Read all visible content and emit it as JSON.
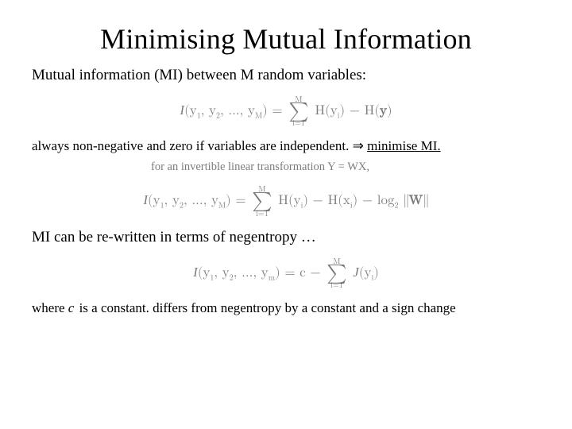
{
  "title": "Minimising Mutual Information",
  "subtitle": "Mutual information (MI) between M random variables:",
  "eq1": {
    "lhs": "I(y₁, y₂, …, y_M) = ",
    "sum_top": "M",
    "sum_bottom": "i=1",
    "term1": "H(yᵢ) − H(y)"
  },
  "note_line": {
    "lead": "always non-negative and zero if variables are independent.",
    "arrow": " ⇒ ",
    "emph": "minimise MI."
  },
  "transform_caption": "for an invertible linear transformation  Y = WX,",
  "eq2": {
    "lhs": "I(y₁, y₂, …, y_M) = ",
    "sum_top": "M",
    "sum_bottom": "i=1",
    "mid": "H(yᵢ) − H(xᵢ) − log₂ ∥W∥"
  },
  "mi_rewrite": "MI can be re-written in terms of negentropy …",
  "eq3": {
    "lhs": "I(y₁, y₂, …, y_m) = c − ",
    "sum_top": "M",
    "sum_bottom": "i=1",
    "term": "J(yᵢ)"
  },
  "final_caption": {
    "pre": "where ",
    "c": "c",
    "post": " is a constant. differs from negentropy by a constant and a sign change"
  }
}
